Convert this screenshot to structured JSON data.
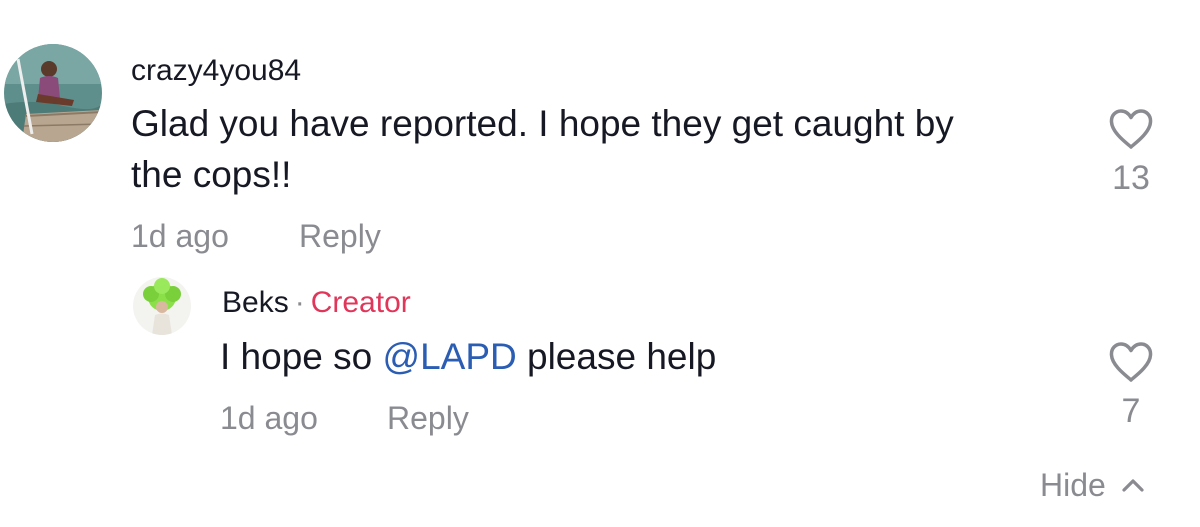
{
  "comment": {
    "username": "crazy4you84",
    "text_line1": "Glad you have reported. I hope they get caught by",
    "text_line2": "the cops!!",
    "time": "1d ago",
    "reply_label": "Reply",
    "like_count": "13",
    "like_icon": "heart-outline-icon"
  },
  "reply": {
    "username": "Beks",
    "separator": "·",
    "creator_label": "Creator",
    "text_prefix": "I hope so ",
    "mention": "@LAPD",
    "text_suffix": " please help",
    "time": "1d ago",
    "reply_label": "Reply",
    "like_count": "7",
    "like_icon": "heart-outline-icon"
  },
  "footer": {
    "hide_label": "Hide",
    "hide_icon": "chevron-up-icon"
  },
  "colors": {
    "text": "#161823",
    "muted": "#8a8b91",
    "mention": "#2b5db3",
    "creator": "#e0365a"
  }
}
